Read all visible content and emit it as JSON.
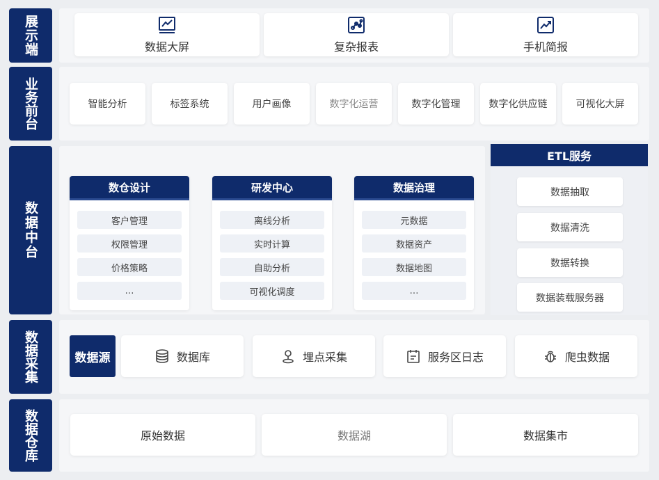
{
  "layers": {
    "display": {
      "label": "展示端",
      "items": [
        {
          "label": "数据大屏",
          "icon": "dashboard-chart-icon"
        },
        {
          "label": "复杂报表",
          "icon": "scatter-chart-icon"
        },
        {
          "label": "手机简报",
          "icon": "trend-chart-icon"
        }
      ]
    },
    "business": {
      "label": "业务前台",
      "items": [
        "智能分析",
        "标签系统",
        "用户画像",
        "数字化运营",
        "数字化管理",
        "数字化供应链",
        "可视化大屏"
      ]
    },
    "middle": {
      "label": "数据中台",
      "groups": [
        {
          "title": "数仓设计",
          "items": [
            "客户管理",
            "权限管理",
            "价格策略",
            "…"
          ]
        },
        {
          "title": "研发中心",
          "items": [
            "离线分析",
            "实时计算",
            "自助分析",
            "可视化调度"
          ]
        },
        {
          "title": "数据治理",
          "items": [
            "元数据",
            "数据资产",
            "数据地图",
            "…"
          ]
        }
      ],
      "etl": {
        "title": "ETL服务",
        "items": [
          "数据抽取",
          "数据清洗",
          "数据转换",
          "数据装载服务器"
        ]
      }
    },
    "collection": {
      "label": "数据采集",
      "source_label": "数据源",
      "items": [
        {
          "label": "数据库",
          "icon": "database-icon"
        },
        {
          "label": "埋点采集",
          "icon": "map-pin-icon"
        },
        {
          "label": "服务区日志",
          "icon": "calendar-log-icon"
        },
        {
          "label": "爬虫数据",
          "icon": "bug-icon"
        }
      ]
    },
    "warehouse": {
      "label": "数据仓库",
      "items": [
        "原始数据",
        "数据湖",
        "数据集市"
      ]
    }
  },
  "colors": {
    "primary": "#0f2b6b",
    "background": "#eceef1",
    "band": "#f5f6f8",
    "item_bg": "#eef1f6"
  }
}
